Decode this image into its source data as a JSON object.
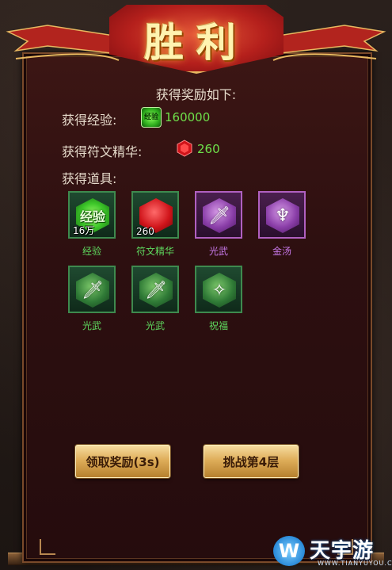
{
  "title": "胜利",
  "rewards": {
    "heading": "获得奖励如下:",
    "exp_label": "获得经验:",
    "exp_value": "160000",
    "exp_icon_text": "经验",
    "rune_label": "获得符文精华:",
    "rune_value": "260",
    "items_label": "获得道具:"
  },
  "items": [
    {
      "name": "经验",
      "qty": "16万",
      "icon": "exp-orb-icon",
      "glyph": "经验",
      "rarity": "green"
    },
    {
      "name": "符文精华",
      "qty": "260",
      "icon": "red-gem-icon",
      "glyph": "",
      "rarity": "green"
    },
    {
      "name": "光武",
      "qty": "",
      "icon": "sword-icon",
      "glyph": "🗡",
      "rarity": "purple"
    },
    {
      "name": "金汤",
      "qty": "",
      "icon": "horned-helm-icon",
      "glyph": "♆",
      "rarity": "purple"
    },
    {
      "name": "光武",
      "qty": "",
      "icon": "sword-icon",
      "glyph": "🗡",
      "rarity": "green"
    },
    {
      "name": "光武",
      "qty": "",
      "icon": "sword-icon",
      "glyph": "🗡",
      "rarity": "green"
    },
    {
      "name": "祝福",
      "qty": "",
      "icon": "blessing-rune-icon",
      "glyph": "✧",
      "rarity": "green"
    }
  ],
  "buttons": {
    "claim": "领取奖励(3s)",
    "challenge": "挑战第4层"
  },
  "colors": {
    "green_text": "#5ed85e",
    "purple_text": "#c678e8",
    "value_green": "#6ee04a"
  },
  "watermark": {
    "logo": "W",
    "name": "天宇游",
    "site": "WWW.TIANYUYOU.COM"
  }
}
